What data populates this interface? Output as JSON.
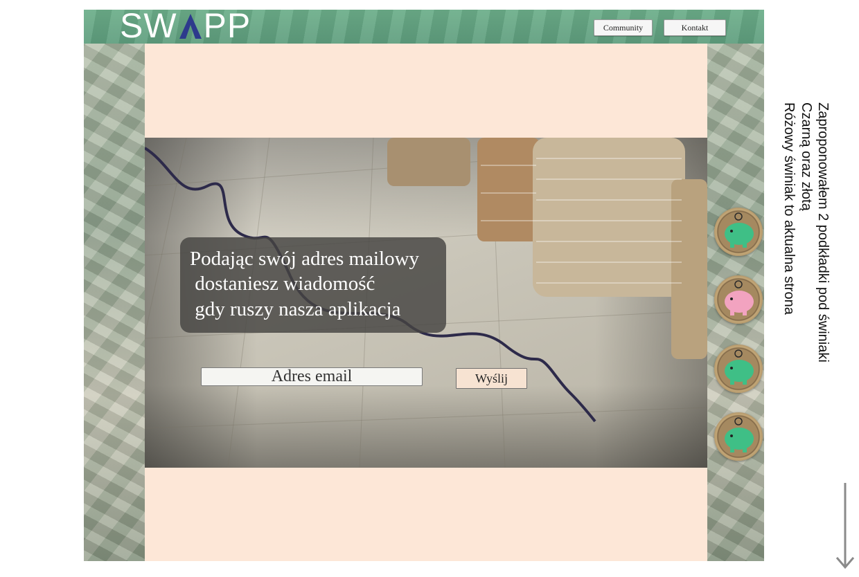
{
  "header": {
    "logo_text_left": "SW",
    "logo_text_right": "PP",
    "nav": [
      {
        "label": "Community"
      },
      {
        "label": "Kontakt"
      }
    ]
  },
  "hero": {
    "message_lines": [
      "Podając swój adres mailowy",
      " dostaniesz wiadomość",
      " gdy ruszy nasza aplikacja"
    ],
    "email_placeholder": "Adres email",
    "send_label": "Wyślij"
  },
  "side_badges": [
    {
      "icon": "piggy-bank-icon",
      "color": "#3fbf86"
    },
    {
      "icon": "piggy-bank-icon",
      "color": "#f2a3c0"
    },
    {
      "icon": "piggy-bank-icon",
      "color": "#3fbf86"
    },
    {
      "icon": "piggy-bank-icon",
      "color": "#3fbf86"
    }
  ],
  "annotation": {
    "lines": [
      "Zaproponowałem 2 podkładki pod świniaki",
      "Czarną oraz złotą",
      "Różowy świniak to aktualna strona"
    ],
    "arrow_icon": "arrow-down-icon"
  },
  "colors": {
    "header_green": "#5f9e7e",
    "content_peach": "#fde7d7",
    "logo_accent": "#2d3a8c"
  }
}
